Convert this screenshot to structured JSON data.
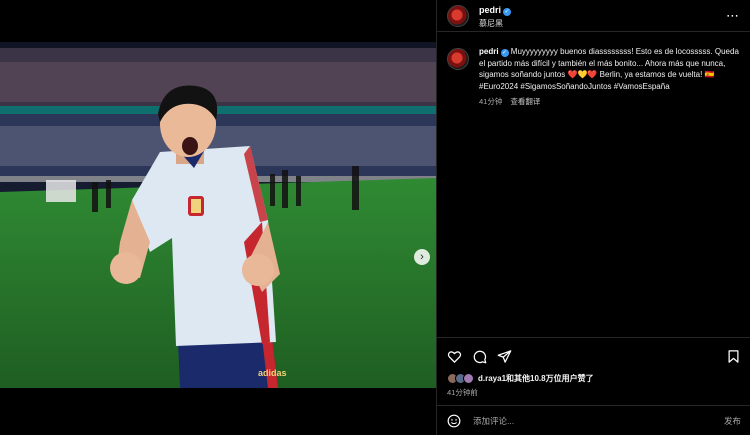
{
  "post": {
    "username": "pedri",
    "verified_mark": "✓",
    "location": "慕尼黑"
  },
  "caption": {
    "username": "pedri",
    "text": "Muyyyyyyyyy buenos diassssssss! Esto es de locosssss. Queda el partido más difícil y también el más bonito... Ahora más que nunca, sigamos soñando juntos ❤️💛❤️ Berlin, ya estamos de vuelta! 🇪🇸 #Euro2024 #SigamosSoñandoJuntos #VamosEspaña",
    "time": "41分钟",
    "translate": "查看翻译"
  },
  "likes": {
    "text": "d.raya1和其他10.8万位用户赞了",
    "time": "41分钟前"
  },
  "comment": {
    "placeholder": "添加评论...",
    "post_label": "发布"
  },
  "carousel": {
    "next_glyph": "›",
    "slide_count": 3,
    "active_index": 0
  },
  "colors": {
    "background": "#000000",
    "verified": "#3897f0",
    "muted": "#a8a8a8",
    "jersey": "#dde8f2",
    "pitch": "#2f7d2f"
  },
  "icons": [
    "more-icon",
    "heart-icon",
    "comment-icon",
    "share-icon",
    "save-icon",
    "emoji-icon",
    "user-tag-icon",
    "chevron-right-icon"
  ]
}
